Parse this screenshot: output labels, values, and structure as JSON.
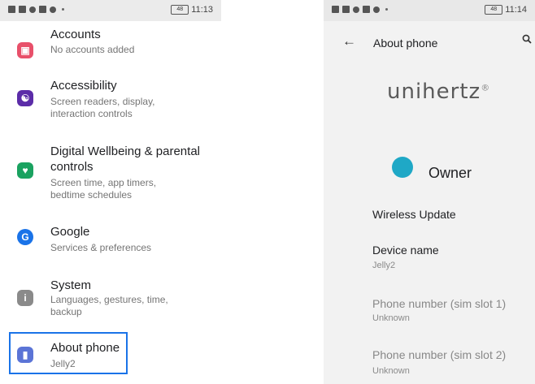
{
  "left_screen": {
    "status": {
      "time": "11:13",
      "battery": "48"
    },
    "items": [
      {
        "title": "Accounts",
        "subtitle": "No accounts added",
        "icon": "account-icon",
        "color": "#e8506a"
      },
      {
        "title": "Accessibility",
        "subtitle": "Screen readers, display, interaction controls",
        "icon": "accessibility-icon",
        "color": "#5b2ca8"
      },
      {
        "title": "Digital Wellbeing & parental controls",
        "subtitle": "Screen time, app timers, bedtime schedules",
        "icon": "wellbeing-icon",
        "color": "#1aa260"
      },
      {
        "title": "Google",
        "subtitle": "Services & preferences",
        "icon": "google-icon",
        "color": "#1a73e8"
      },
      {
        "title": "System",
        "subtitle": "Languages, gestures, time, backup",
        "icon": "info-icon",
        "color": "#8a8a8a"
      },
      {
        "title": "About phone",
        "subtitle": "Jelly2",
        "icon": "phone-icon",
        "color": "#5b74d6"
      }
    ]
  },
  "right_screen": {
    "status": {
      "time": "11:14",
      "battery": "48"
    },
    "title": "About phone",
    "logo": "unihertz",
    "owner": "Owner",
    "items": [
      {
        "title": "Wireless Update",
        "subtitle": ""
      },
      {
        "title": "Device name",
        "subtitle": "Jelly2"
      },
      {
        "title": "Phone number (sim slot 1)",
        "subtitle": "Unknown"
      },
      {
        "title": "Phone number (sim slot 2)",
        "subtitle": "Unknown"
      }
    ]
  }
}
